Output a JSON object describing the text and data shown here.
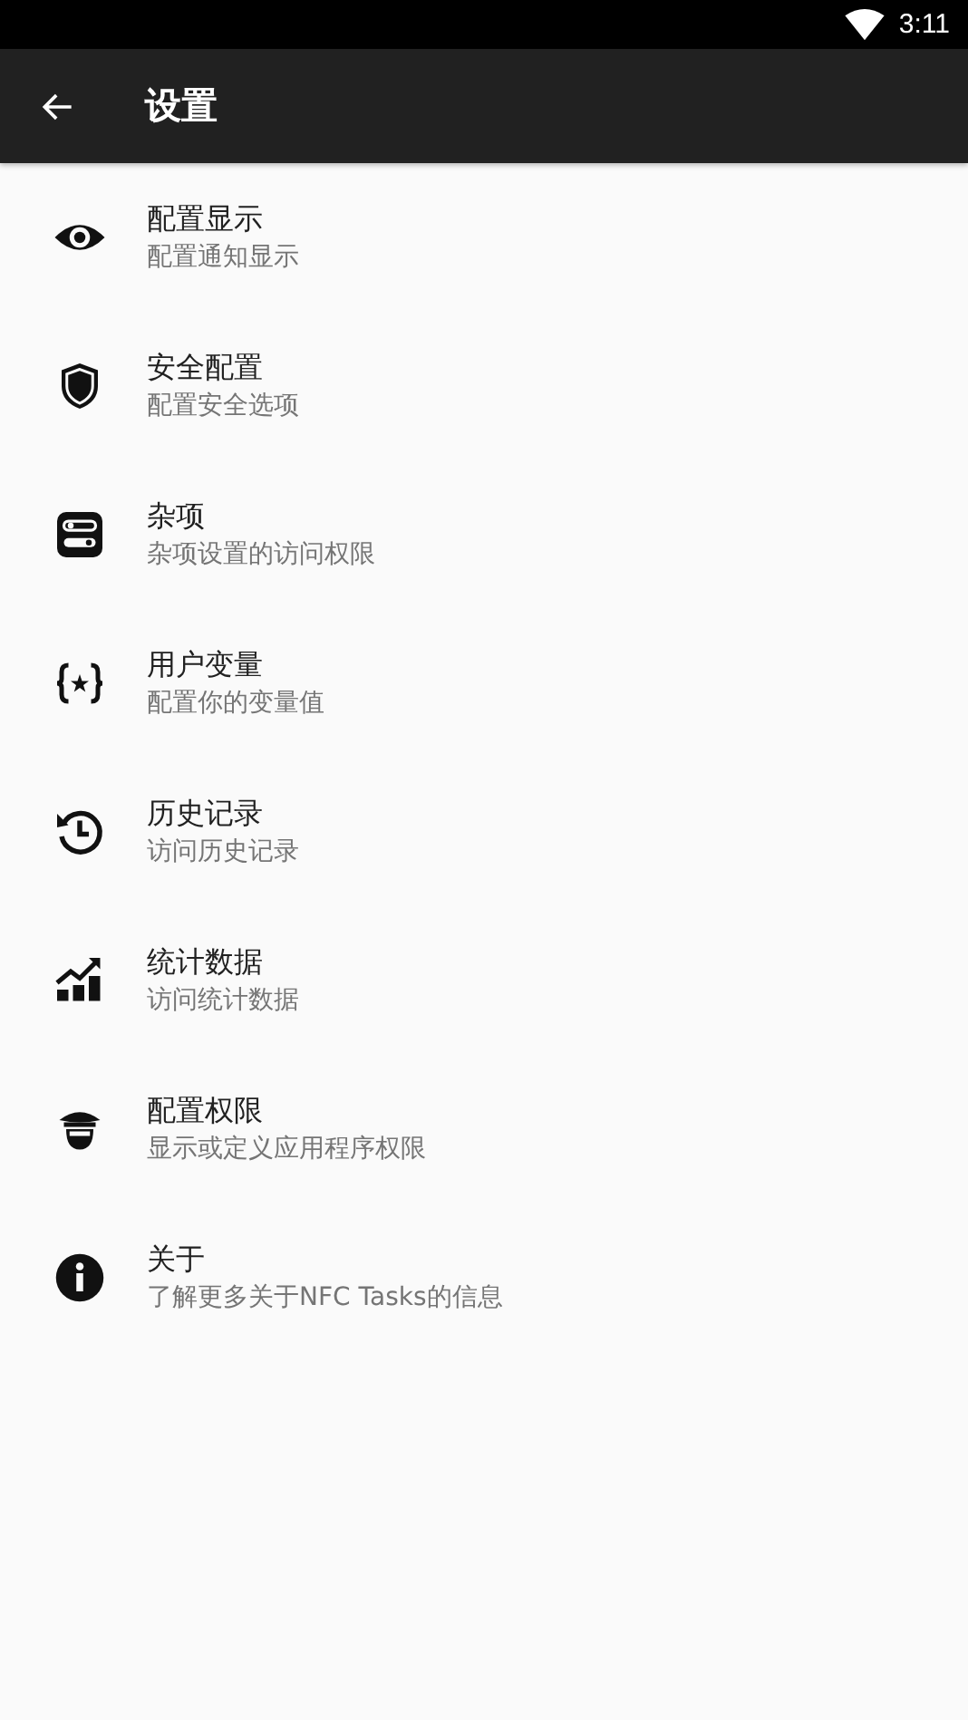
{
  "status_bar": {
    "time": "3:11"
  },
  "toolbar": {
    "title": "设置"
  },
  "items": [
    {
      "title": "配置显示",
      "subtitle": "配置通知显示"
    },
    {
      "title": "安全配置",
      "subtitle": "配置安全选项"
    },
    {
      "title": "杂项",
      "subtitle": "杂项设置的访问权限"
    },
    {
      "title": "用户变量",
      "subtitle": "配置你的变量值"
    },
    {
      "title": "历史记录",
      "subtitle": "访问历史记录"
    },
    {
      "title": "统计数据",
      "subtitle": "访问统计数据"
    },
    {
      "title": "配置权限",
      "subtitle": "显示或定义应用程序权限"
    },
    {
      "title": "关于",
      "subtitle": "了解更多关于NFC Tasks的信息"
    }
  ]
}
